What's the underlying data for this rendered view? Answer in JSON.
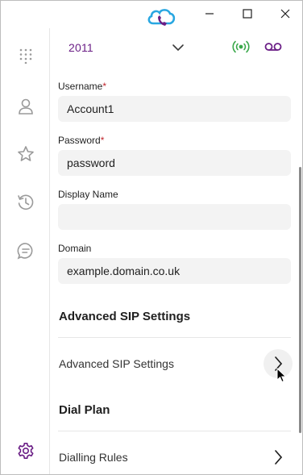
{
  "window": {
    "controls": {
      "minimize_icon": "minimize-icon",
      "maximize_icon": "maximize-icon",
      "close_icon": "close-icon"
    }
  },
  "colors": {
    "accent": "#6b1f86",
    "signal": "#3aa84a",
    "required": "#c0262d",
    "logo_blue": "#29a7e1"
  },
  "rail": {
    "items": [
      {
        "name": "dialpad-icon"
      },
      {
        "name": "contacts-icon"
      },
      {
        "name": "favorites-icon"
      },
      {
        "name": "history-icon"
      },
      {
        "name": "chat-icon"
      },
      {
        "name": "settings-icon"
      }
    ]
  },
  "topbar": {
    "selected_line": "2011"
  },
  "form": {
    "username": {
      "label": "Username",
      "required": "*",
      "value": "Account1"
    },
    "password": {
      "label": "Password",
      "required": "*",
      "value": "password"
    },
    "display_name": {
      "label": "Display Name",
      "value": ""
    },
    "domain": {
      "label": "Domain",
      "value": "example.domain.co.uk"
    }
  },
  "sections": {
    "advanced": {
      "title": "Advanced SIP Settings",
      "row_label": "Advanced SIP Settings"
    },
    "dial_plan": {
      "title": "Dial Plan",
      "row_label": "Dialling Rules"
    }
  }
}
